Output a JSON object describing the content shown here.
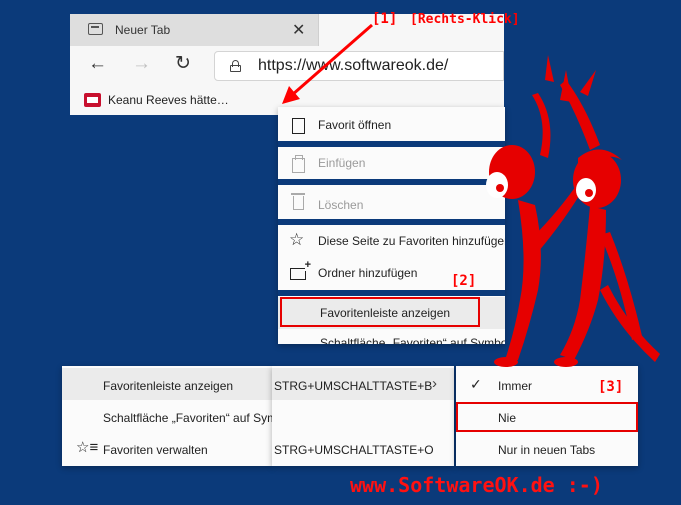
{
  "browser": {
    "tab_title": "Neuer Tab",
    "tab_close": "✕",
    "url": "https://www.softwareok.de/",
    "favorite_label": "Keanu Reeves hätte…"
  },
  "context_menu": {
    "items": [
      {
        "label": "Favorit öffnen",
        "icon": "page-icon",
        "disabled": false
      },
      {
        "label": "Einfügen",
        "icon": "paste-icon",
        "disabled": true
      },
      {
        "label": "Löschen",
        "icon": "trash-icon",
        "disabled": true
      },
      {
        "label": "Diese Seite zu Favoriten hinzufügen",
        "icon": "star-add-icon",
        "disabled": false
      },
      {
        "label": "Ordner hinzufügen",
        "icon": "folder-add-icon",
        "disabled": false
      },
      {
        "label": "Favoritenleiste anzeigen",
        "icon": "",
        "disabled": false
      },
      {
        "label": "Schaltfläche „Favoriten“ auf Symbolleiste anzeigen",
        "icon": "",
        "disabled": false
      }
    ]
  },
  "submenu": {
    "rows": [
      {
        "label": "Favoritenleiste anzeigen",
        "shortcut": "STRG+UMSCHALTTASTE+B",
        "has_arrow": true
      },
      {
        "label": "Schaltfläche „Favoriten“ auf Symbolleiste anzeigen",
        "shortcut": "",
        "has_arrow": false
      },
      {
        "label": "Favoriten verwalten",
        "shortcut": "STRG+UMSCHALTTASTE+O",
        "has_arrow": false
      }
    ]
  },
  "visibility_menu": {
    "options": [
      {
        "label": "Immer",
        "checked": true
      },
      {
        "label": "Nie",
        "checked": false
      },
      {
        "label": "Nur in neuen Tabs",
        "checked": false
      }
    ]
  },
  "annotations": {
    "step1": "[1]",
    "right_click": "[Rechts-Klick]",
    "step2": "[2]",
    "step3": "[3]",
    "watermark": "www.SoftwareOK.de :-)"
  },
  "colors": {
    "background": "#0b3a7a",
    "annotation_red": "#ff0000"
  }
}
